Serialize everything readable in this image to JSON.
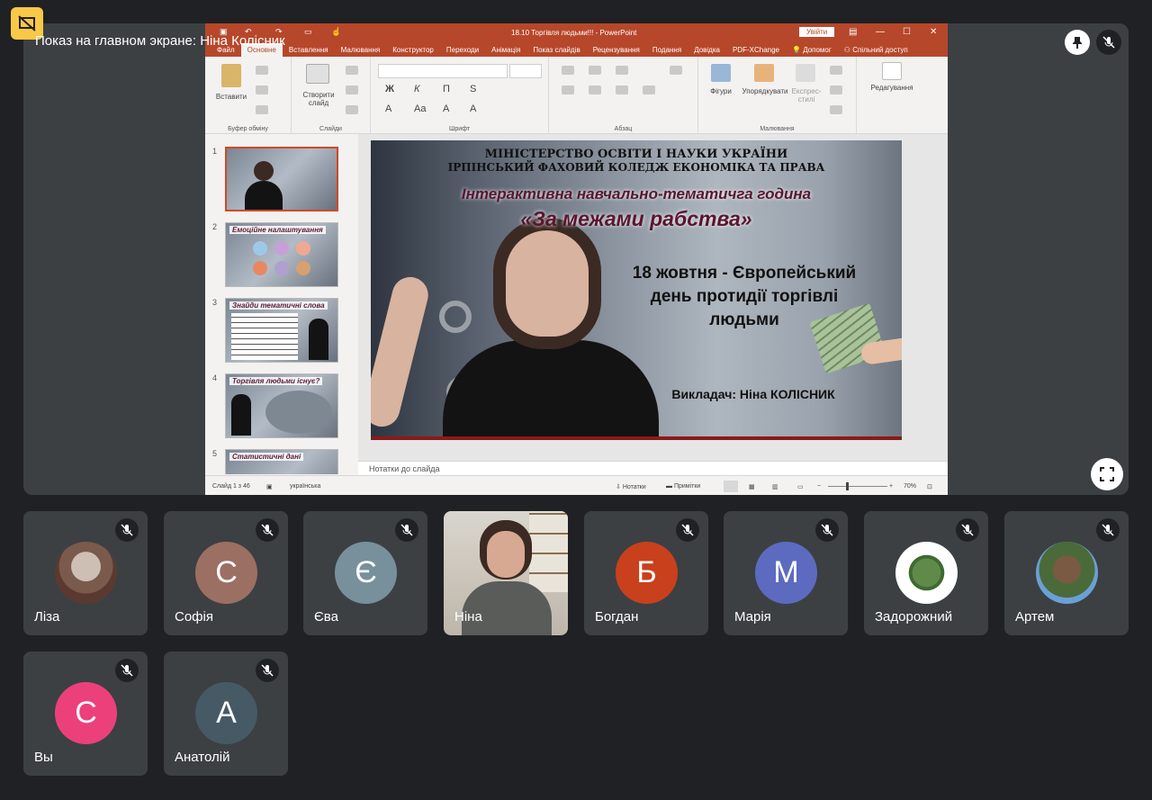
{
  "banner": {
    "presenting_label": "Показ на главном экране: Ніна Колісник"
  },
  "ppt": {
    "window_title": "18.10 Торгівля людьми!!! - PowerPoint",
    "sign_in": "Увійти",
    "tabs": [
      "Файл",
      "Основне",
      "Вставлення",
      "Малювання",
      "Конструктор",
      "Переходи",
      "Анімація",
      "Показ слайдів",
      "Рецензування",
      "Подання",
      "Довідка",
      "PDF-XChange",
      "Допомог",
      "Спільний доступ"
    ],
    "ribbon": {
      "paste": "Вставити",
      "new_slide": "Створити слайд",
      "shapes": "Фігури",
      "arrange": "Упорядкувати",
      "quick_styles": "Експрес-стилі",
      "editing": "Редагування",
      "groups": [
        "Буфер обміну",
        "Слайди",
        "Шрифт",
        "Абзац",
        "Малювання"
      ]
    },
    "thumbnails": [
      {
        "num": "1",
        "title": ""
      },
      {
        "num": "2",
        "title": "Емоційне налаштування"
      },
      {
        "num": "3",
        "title": "Знайди тематичні слова"
      },
      {
        "num": "4",
        "title": "Торгівля людьми існує?"
      },
      {
        "num": "5",
        "title": "Статистичні дані"
      }
    ],
    "slide": {
      "line1": "МІНІСТЕРСТВО ОСВІТИ І НАУКИ УКРАЇНИ",
      "line2": "ІРПІНСЬКИЙ ФАХОВИЙ КОЛЕДЖ ЕКОНОМІКА ТА ПРАВА",
      "line3": "Інтерактивна навчально-тематичга година",
      "line4": "«За межами рабства»",
      "date1": "18 жовтня - Європейський",
      "date2": "день протидії торгівлі",
      "date3": "людьми",
      "teacher": "Викладач: Ніна КОЛІСНИК"
    },
    "notes_placeholder": "Нотатки до слайда",
    "status": {
      "slide_count": "Слайд 1 з 46",
      "language": "українська",
      "notes": "Нотатки",
      "comments": "Примітки",
      "zoom": "70%"
    }
  },
  "participants": [
    {
      "name": "Ліза",
      "initial": "",
      "color": "#7a5a4c",
      "muted": true
    },
    {
      "name": "Софія",
      "initial": "С",
      "color": "#9c6f63",
      "muted": true
    },
    {
      "name": "Єва",
      "initial": "Є",
      "color": "#78909c",
      "muted": true
    },
    {
      "name": "Ніна",
      "initial": "",
      "color": "",
      "muted": false
    },
    {
      "name": "Богдан",
      "initial": "Б",
      "color": "#c9401d",
      "muted": true
    },
    {
      "name": "Марія",
      "initial": "М",
      "color": "#5c6bc0",
      "muted": true
    },
    {
      "name": "Задорожний",
      "initial": "",
      "color": "#ffffff",
      "muted": true
    },
    {
      "name": "Артем",
      "initial": "",
      "color": "#4a6a3a",
      "muted": true
    },
    {
      "name": "Вы",
      "initial": "С",
      "color": "#ec407a",
      "muted": true
    },
    {
      "name": "Анатолій",
      "initial": "А",
      "color": "#455a64",
      "muted": true
    }
  ]
}
